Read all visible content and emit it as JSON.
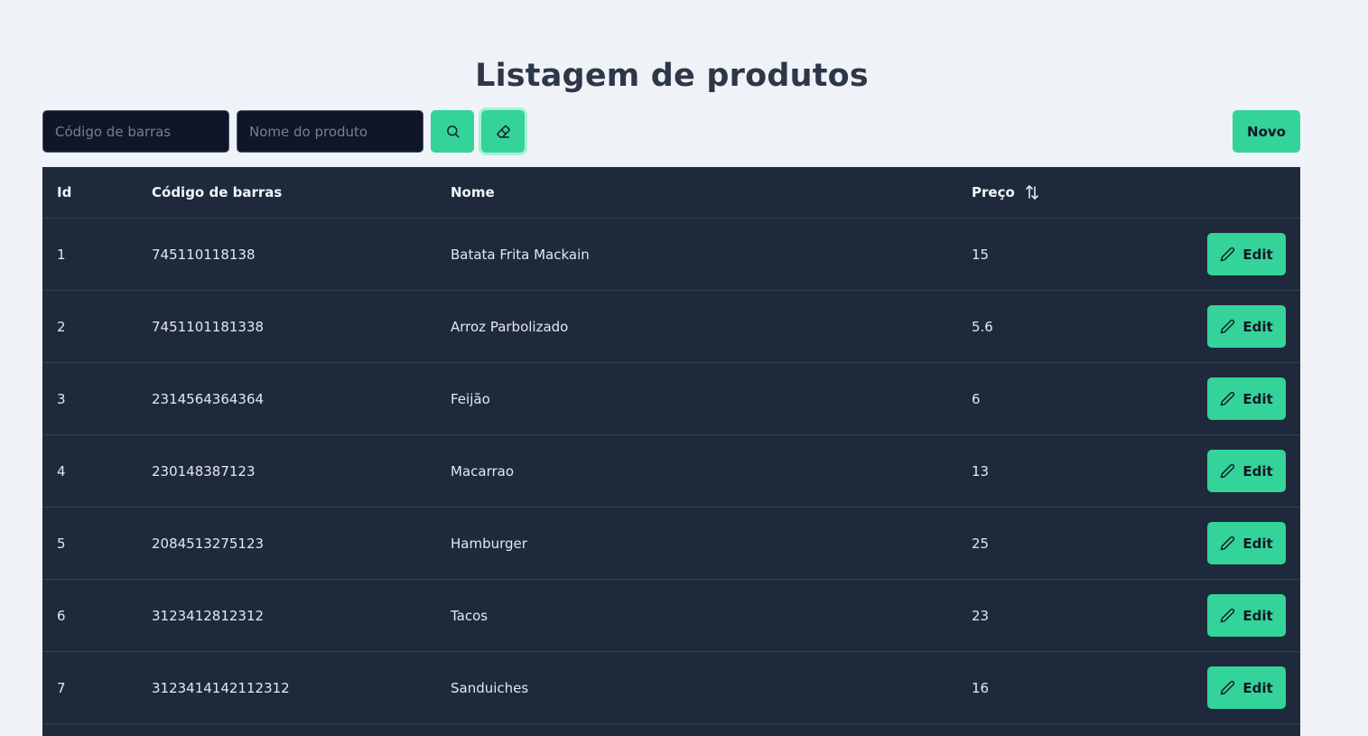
{
  "title": "Listagem de produtos",
  "filters": {
    "barcode_placeholder": "Código de barras",
    "name_placeholder": "Nome do produto",
    "search_icon": "search-icon",
    "clear_icon": "eraser-icon"
  },
  "toolbar": {
    "new_label": "Novo"
  },
  "table": {
    "headers": {
      "id": "Id",
      "barcode": "Código de barras",
      "name": "Nome",
      "price": "Preço"
    },
    "sort_icon": "sort-arrows-icon",
    "edit_label": "Edit",
    "edit_icon": "pencil-icon",
    "rows": [
      {
        "id": "1",
        "barcode": "745110118138",
        "name": "Batata Frita Mackain",
        "price": "15"
      },
      {
        "id": "2",
        "barcode": "7451101181338",
        "name": "Arroz Parbolizado",
        "price": "5.6"
      },
      {
        "id": "3",
        "barcode": "2314564364364",
        "name": "Feijão",
        "price": "6"
      },
      {
        "id": "4",
        "barcode": "230148387123",
        "name": "Macarrao",
        "price": "13"
      },
      {
        "id": "5",
        "barcode": "2084513275123",
        "name": "Hamburger",
        "price": "25"
      },
      {
        "id": "6",
        "barcode": "3123412812312",
        "name": "Tacos",
        "price": "23"
      },
      {
        "id": "7",
        "barcode": "3123414142112312",
        "name": "Sanduiches",
        "price": "16"
      }
    ]
  },
  "colors": {
    "background": "#eff3f8",
    "accent": "#34d399",
    "table_bg": "#1e293b",
    "input_bg": "#0e1628"
  }
}
